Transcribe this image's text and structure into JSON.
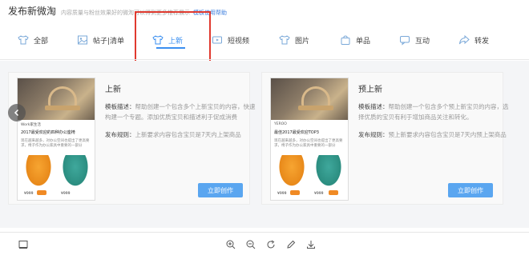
{
  "header": {
    "title": "发布新微淘",
    "subtitle": "内容质量与粉丝效果好的微淘可以得到更多推荐展示",
    "help_link": "模板使用帮助"
  },
  "tabs": [
    {
      "label": "全部",
      "icon": "shirt-icon"
    },
    {
      "label": "帖子|清单",
      "icon": "image-list-icon"
    },
    {
      "label": "上新",
      "icon": "shirt-icon",
      "active": true
    },
    {
      "label": "短视频",
      "icon": "video-icon"
    },
    {
      "label": "图片",
      "icon": "shirt-icon"
    },
    {
      "label": "单品",
      "icon": "bag-icon"
    },
    {
      "label": "互动",
      "icon": "chat-icon"
    },
    {
      "label": "转发",
      "icon": "share-icon"
    }
  ],
  "cards": [
    {
      "title": "上新",
      "desc_label": "模板描述：",
      "desc_text": "帮助创建一个包含多个上新宝贝的内容，快速构建一个专题。添加优质宝贝和描述利于促成消费",
      "rule_label": "发布规则：",
      "rule_text": "上新要求内容包含宝贝是7天内上架商品",
      "button": "立即创作",
      "thumb": {
        "shop": "Work家生活",
        "headline": "2017最受欢迎的四种办公座椅",
        "body": "现在越来越多，对办公空间也提出了更高要求，椅子作为办公家具中重要的一部分",
        "price_a": "¥999",
        "price_b": "¥999"
      }
    },
    {
      "title": "预上新",
      "desc_label": "模板描述：",
      "desc_text": "帮助创建一个包含多个预上新宝贝的内容，选择优质的宝贝有利于增加商品关注和转化。",
      "rule_label": "发布规则：",
      "rule_text": "预上新要求内容包含宝贝是7天内预上架商品",
      "button": "立即创作",
      "thumb": {
        "shop": "YEROO",
        "headline": "最佳2017最受欢迎TOP3",
        "body": "现在越来越多，对办公空间也提出了更高要求，椅子作为办公家具中重要的一部分",
        "price_a": "¥999",
        "price_b": "¥999"
      }
    }
  ],
  "colors": {
    "accent": "#3b8ff0",
    "button": "#5aa6f0",
    "highlight": "#e03a2f"
  },
  "bottom_toolbar": [
    "image-icon",
    "zoom-in-icon",
    "zoom-out-icon",
    "rotate-icon",
    "edit-icon",
    "download-icon"
  ]
}
